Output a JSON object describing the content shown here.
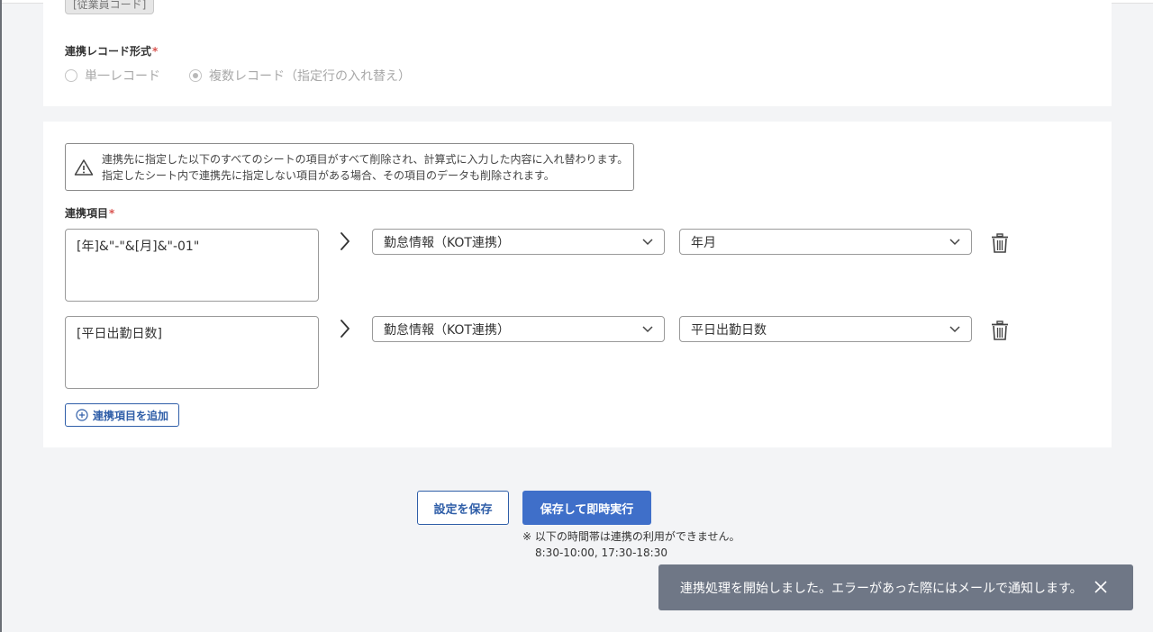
{
  "top_section": {
    "tag_chip": "[従業員コード]",
    "record_format_label": "連携レコード形式",
    "required_mark": "*",
    "radio_options": [
      {
        "label": "単一レコード",
        "selected": false
      },
      {
        "label": "複数レコード（指定行の入れ替え）",
        "selected": true
      }
    ]
  },
  "warning": {
    "icon": "warning-triangle-icon",
    "line1": "連携先に指定した以下のすべてのシートの項目がすべて削除され、計算式に入力した内容に入れ替わります。",
    "line2": "指定したシート内で連携先に指定しない項目がある場合、その項目のデータも削除されます。"
  },
  "mapping": {
    "label": "連携項目",
    "required_mark": "*",
    "rows": [
      {
        "formula": "[年]&\"-\"&[月]&\"-01\"",
        "sheet": "勤怠情報（KOT連携）",
        "field": "年月"
      },
      {
        "formula": "[平日出勤日数]",
        "sheet": "勤怠情報（KOT連携）",
        "field": "平日出勤日数"
      }
    ],
    "add_button": "連携項目を追加"
  },
  "actions": {
    "save_label": "設定を保存",
    "run_label": "保存して即時実行",
    "note_line1": "※ 以下の時間帯は連携の利用ができません。",
    "note_line2": "8:30-10:00, 17:30-18:30"
  },
  "toast": {
    "message": "連携処理を開始しました。エラーがあった際にはメールで通知します。"
  }
}
